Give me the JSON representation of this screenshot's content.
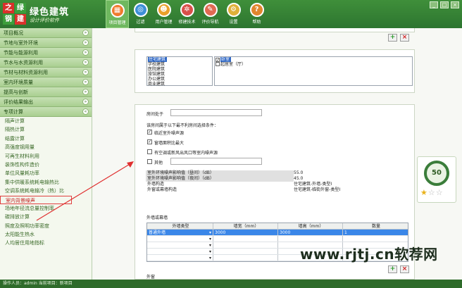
{
  "app": {
    "logo_chars": [
      "之",
      "绿",
      "钢",
      "建"
    ],
    "title": "绿色建筑",
    "subtitle": "设计评价软件"
  },
  "toolbar": [
    {
      "label": "项目管理",
      "icon": "project-icon",
      "glyph": "▦"
    },
    {
      "label": "过滤",
      "icon": "filter-icon",
      "glyph": "◎"
    },
    {
      "label": "用户管理",
      "icon": "users-icon",
      "glyph": "☻"
    },
    {
      "label": "修建技术",
      "icon": "tools-icon",
      "glyph": "✲"
    },
    {
      "label": "评价导航",
      "icon": "navigation-icon",
      "glyph": "✎"
    },
    {
      "label": "设置",
      "icon": "settings-icon",
      "glyph": "⚙"
    },
    {
      "label": "帮助",
      "icon": "help-icon",
      "glyph": "?"
    }
  ],
  "window_controls": [
    "_",
    "□",
    "×"
  ],
  "sidebar": {
    "categories": [
      "项目概况",
      "节地与室外环境",
      "节能与能源利用",
      "节水与水资源利用",
      "节材与材料资源利用",
      "室内环境质量",
      "提高与创新",
      "评价结果输出",
      "专项计算"
    ],
    "items": [
      "隔声计算",
      "隔热计算",
      "结露计算",
      "高强度钢用量",
      "可再生材料利用",
      "装饰性构件造价",
      "单位风量耗功率",
      "集中供暖系统耗电输热比",
      "空调系统耗电输冷（热）比",
      "室内背景噪声",
      "场地年径流总量控制率",
      "碳排放计算",
      "照度及照明功率密度",
      "太阳能生热水",
      "人均居住用地指标"
    ],
    "highlighted_index": 9
  },
  "listboxes": {
    "building_types": [
      "住宅建筑",
      "学校建筑",
      "医院建筑",
      "旅馆建筑",
      "办公建筑",
      "商业建筑"
    ],
    "room_types": [
      "卧室",
      "起居室（厅）"
    ],
    "check_mark": "✓"
  },
  "form": {
    "room_label": "房间处于",
    "condition_label": "该房间属于以下最不利房间选择条件：",
    "conditions": [
      {
        "label": "临近室外噪声源",
        "checked": true
      },
      {
        "label": "窗墙面积比最大",
        "checked": true
      },
      {
        "label": "有空调或新风出风口等室内噪声源",
        "checked": false
      },
      {
        "label": "其他",
        "checked": false
      }
    ]
  },
  "info": [
    {
      "key": "室外环境噪声影响值（昼间）（dB）",
      "value": "55.0",
      "shaded": true
    },
    {
      "key": "室外环境噪声影响值（夜间）（dB）",
      "value": "45.0",
      "shaded": true
    },
    {
      "key": "外墙构造",
      "value": "住宅建筑-外墙-类型I",
      "shaded": false
    },
    {
      "key": "外窗或幕墙构造",
      "value": "住宅建筑-临街外窗-类型I",
      "shaded": false
    }
  ],
  "wall_section": {
    "title": "外墙或幕墙",
    "columns": [
      "外墙类型",
      "墙宽（mm）",
      "墙高（mm）",
      "数量"
    ],
    "rows": [
      {
        "type": "普通外墙",
        "width": "3000",
        "height": "3000",
        "count": "1"
      },
      {
        "type": "",
        "width": "",
        "height": "",
        "count": ""
      },
      {
        "type": "",
        "width": "",
        "height": "",
        "count": ""
      },
      {
        "type": "",
        "width": "",
        "height": "",
        "count": ""
      },
      {
        "type": "",
        "width": "",
        "height": "",
        "count": ""
      }
    ],
    "dropdown_glyph": "▾"
  },
  "window_section": {
    "title": "外窗"
  },
  "buttons": {
    "add": "+",
    "delete": "×"
  },
  "score_widget": {
    "score": "50",
    "stars_on": "★",
    "stars_off": "☆☆"
  },
  "watermark": "www.rjtj.cn软荐网",
  "statusbar": "操作人员：admin  当前项目：新项目",
  "colors": {
    "brand_green": "#2d7530",
    "highlight_red": "#e04040",
    "selection_blue": "#3a86e8"
  }
}
